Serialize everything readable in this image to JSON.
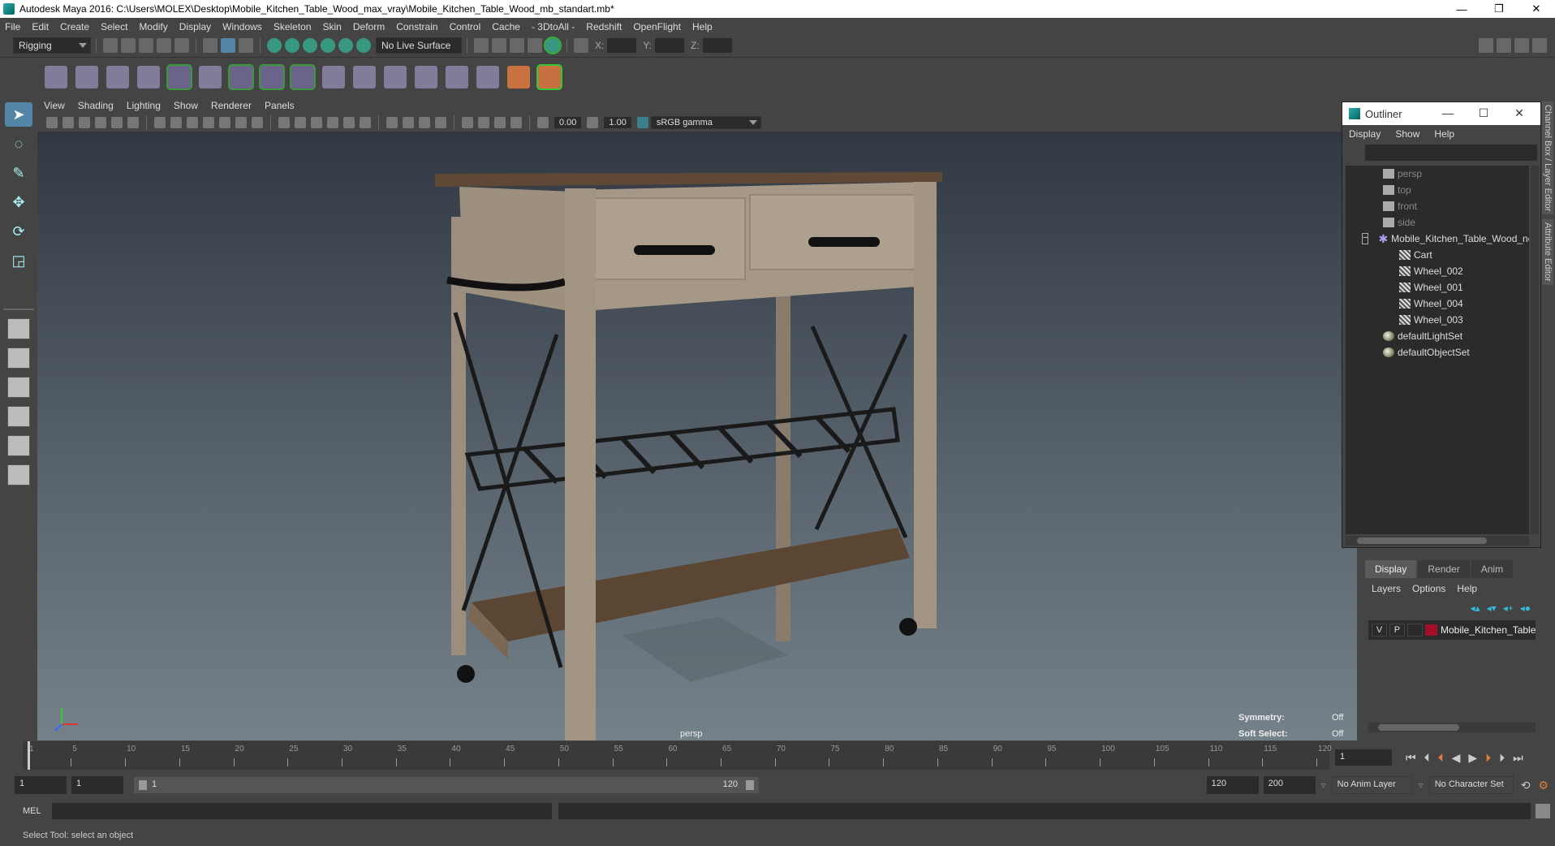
{
  "window": {
    "title": "Autodesk Maya 2016: C:\\Users\\MOLEX\\Desktop\\Mobile_Kitchen_Table_Wood_max_vray\\Mobile_Kitchen_Table_Wood_mb_standart.mb*",
    "minimize": "—",
    "maximize": "❐",
    "close": "✕"
  },
  "menubar": [
    "File",
    "Edit",
    "Create",
    "Select",
    "Modify",
    "Display",
    "Windows",
    "Skeleton",
    "Skin",
    "Deform",
    "Constrain",
    "Control",
    "Cache",
    "- 3DtoAll -",
    "Redshift",
    "OpenFlight",
    "Help"
  ],
  "shelf": {
    "mode": "Rigging",
    "live_surface": "No Live Surface",
    "x_label": "X:",
    "y_label": "Y:",
    "z_label": "Z:"
  },
  "panel_menu": [
    "View",
    "Shading",
    "Lighting",
    "Show",
    "Renderer",
    "Panels"
  ],
  "panel_toolbar": {
    "exposure": "0.00",
    "gamma": "1.00",
    "color_space": "sRGB gamma"
  },
  "viewport": {
    "camera_label": "persp",
    "symmetry_label": "Symmetry:",
    "symmetry_value": "Off",
    "soft_select_label": "Soft Select:",
    "soft_select_value": "Off"
  },
  "outliner": {
    "title": "Outliner",
    "menu": [
      "Display",
      "Show",
      "Help"
    ],
    "items": [
      {
        "label": "persp",
        "type": "camera",
        "indent": 1
      },
      {
        "label": "top",
        "type": "camera",
        "indent": 1
      },
      {
        "label": "front",
        "type": "camera",
        "indent": 1
      },
      {
        "label": "side",
        "type": "camera",
        "indent": 1
      },
      {
        "label": "Mobile_Kitchen_Table_Wood_ncl",
        "type": "group",
        "indent": 0,
        "expanded": true
      },
      {
        "label": "Cart",
        "type": "mesh",
        "indent": 2
      },
      {
        "label": "Wheel_002",
        "type": "mesh",
        "indent": 2
      },
      {
        "label": "Wheel_001",
        "type": "mesh",
        "indent": 2
      },
      {
        "label": "Wheel_004",
        "type": "mesh",
        "indent": 2
      },
      {
        "label": "Wheel_003",
        "type": "mesh",
        "indent": 2
      },
      {
        "label": "defaultLightSet",
        "type": "set",
        "indent": 1
      },
      {
        "label": "defaultObjectSet",
        "type": "set",
        "indent": 1
      }
    ]
  },
  "side_tabs": [
    "Channel Box / Layer Editor",
    "Attribute Editor"
  ],
  "layer_editor": {
    "tabs": [
      "Display",
      "Render",
      "Anim"
    ],
    "active_tab": "Display",
    "menu": [
      "Layers",
      "Options",
      "Help"
    ],
    "layers": [
      {
        "v": "V",
        "p": "P",
        "color": "#a0102a",
        "name": "Mobile_Kitchen_Table_"
      }
    ]
  },
  "timeline": {
    "ticks": [
      "1",
      "5",
      "10",
      "15",
      "20",
      "25",
      "30",
      "35",
      "40",
      "45",
      "50",
      "55",
      "60",
      "65",
      "70",
      "75",
      "80",
      "85",
      "90",
      "95",
      "100",
      "105",
      "110",
      "115",
      "120"
    ],
    "current_frame": "1"
  },
  "range": {
    "start": "1",
    "playback_start": "1",
    "slider_start": "1",
    "slider_end": "120",
    "playback_end": "120",
    "end": "200",
    "anim_layer": "No Anim Layer",
    "character_set": "No Character Set"
  },
  "command_line": {
    "label": "MEL"
  },
  "help_line": {
    "text": "Select Tool: select an object"
  }
}
